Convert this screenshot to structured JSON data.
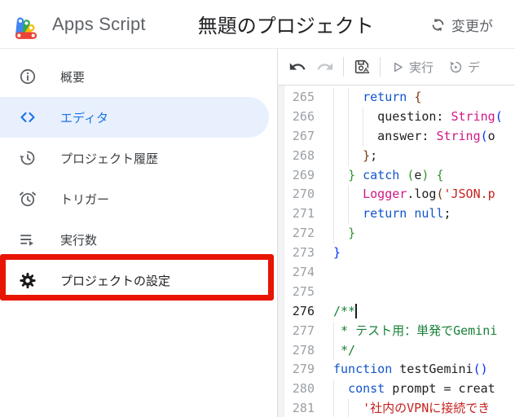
{
  "header": {
    "app_name": "Apps Script",
    "project_title": "無題のプロジェクト",
    "status_text": "変更が",
    "status_icon": "sync-icon"
  },
  "sidebar": {
    "items": [
      {
        "id": "overview",
        "label": "概要",
        "icon": "info-icon"
      },
      {
        "id": "editor",
        "label": "エディタ",
        "icon": "code-icon",
        "active": true
      },
      {
        "id": "project-history",
        "label": "プロジェクト履歴",
        "icon": "history-icon"
      },
      {
        "id": "triggers",
        "label": "トリガー",
        "icon": "alarm-icon"
      },
      {
        "id": "executions",
        "label": "実行数",
        "icon": "executions-icon"
      },
      {
        "id": "project-settings",
        "label": "プロジェクトの設定",
        "icon": "gear-icon",
        "annotated": true
      }
    ]
  },
  "annotation": {
    "color": "#e81404"
  },
  "toolbar": {
    "undo_icon": "undo-icon",
    "redo_icon": "redo-icon",
    "save_icon": "save-with-warning-icon",
    "run": {
      "icon": "play-icon",
      "label": "実行"
    },
    "debug": {
      "icon": "debug-icon",
      "label": "デ"
    }
  },
  "colors": {
    "accent": "#1a73e8",
    "selected_bg": "#e8f0fe",
    "annotation_red": "#e81404",
    "keyword": "#1155cc",
    "string": "#c5221f",
    "comment": "#188038",
    "builtin": "#d01884",
    "bracket1": "#0431fa",
    "bracket2": "#319331",
    "bracket3": "#7b3814",
    "plain": "#202124"
  },
  "code": {
    "lines": [
      {
        "n": "265",
        "g": [
          0,
          2
        ],
        "t": [
          [
            "pln",
            "    "
          ],
          [
            "kw",
            "return"
          ],
          [
            "pln",
            " "
          ],
          [
            "b3",
            "{"
          ]
        ]
      },
      {
        "n": "266",
        "g": [
          0,
          2,
          4
        ],
        "t": [
          [
            "pln",
            "      question: "
          ],
          [
            "blt",
            "String"
          ],
          [
            "b1",
            "("
          ]
        ]
      },
      {
        "n": "267",
        "g": [
          0,
          2,
          4
        ],
        "t": [
          [
            "pln",
            "      answer: "
          ],
          [
            "blt",
            "String"
          ],
          [
            "b1",
            "("
          ],
          [
            "pln",
            "o"
          ]
        ]
      },
      {
        "n": "268",
        "g": [
          0,
          2
        ],
        "t": [
          [
            "pln",
            "    "
          ],
          [
            "b3",
            "}"
          ],
          [
            "pln",
            ";"
          ]
        ]
      },
      {
        "n": "269",
        "g": [
          0
        ],
        "t": [
          [
            "pln",
            "  "
          ],
          [
            "b2",
            "}"
          ],
          [
            "pln",
            " "
          ],
          [
            "kw",
            "catch"
          ],
          [
            "pln",
            " "
          ],
          [
            "b2",
            "("
          ],
          [
            "pln",
            "e"
          ],
          [
            "b2",
            ")"
          ],
          [
            "pln",
            " "
          ],
          [
            "b2",
            "{"
          ]
        ]
      },
      {
        "n": "270",
        "g": [
          0,
          2
        ],
        "t": [
          [
            "pln",
            "    "
          ],
          [
            "blt",
            "Logger"
          ],
          [
            "pln",
            ".log"
          ],
          [
            "b3",
            "("
          ],
          [
            "str",
            "'JSON.p"
          ]
        ]
      },
      {
        "n": "271",
        "g": [
          0,
          2
        ],
        "t": [
          [
            "pln",
            "    "
          ],
          [
            "kw",
            "return"
          ],
          [
            "pln",
            " "
          ],
          [
            "kw",
            "null"
          ],
          [
            "pln",
            ";"
          ]
        ]
      },
      {
        "n": "272",
        "g": [
          0
        ],
        "t": [
          [
            "pln",
            "  "
          ],
          [
            "b2",
            "}"
          ]
        ]
      },
      {
        "n": "273",
        "g": [],
        "t": [
          [
            "b1",
            "}"
          ]
        ]
      },
      {
        "n": "274",
        "g": [],
        "t": []
      },
      {
        "n": "275",
        "g": [],
        "t": []
      },
      {
        "n": "276",
        "g": [],
        "t": [
          [
            "com",
            "/**"
          ]
        ],
        "active": true,
        "cursor": true
      },
      {
        "n": "277",
        "g": [
          0
        ],
        "t": [
          [
            "com",
            " * テスト用：単発でGemini"
          ]
        ]
      },
      {
        "n": "278",
        "g": [
          0
        ],
        "t": [
          [
            "com",
            " */"
          ]
        ]
      },
      {
        "n": "279",
        "g": [],
        "t": [
          [
            "kw",
            "function"
          ],
          [
            "pln",
            " testGemini"
          ],
          [
            "b1",
            "()"
          ],
          [
            "pln",
            " "
          ]
        ]
      },
      {
        "n": "280",
        "g": [
          0
        ],
        "t": [
          [
            "pln",
            "  "
          ],
          [
            "kw",
            "const"
          ],
          [
            "pln",
            " prompt = creat"
          ]
        ]
      },
      {
        "n": "281",
        "g": [
          0,
          2
        ],
        "t": [
          [
            "pln",
            "    "
          ],
          [
            "str",
            "'社内のVPNに接続でき"
          ]
        ]
      }
    ]
  }
}
